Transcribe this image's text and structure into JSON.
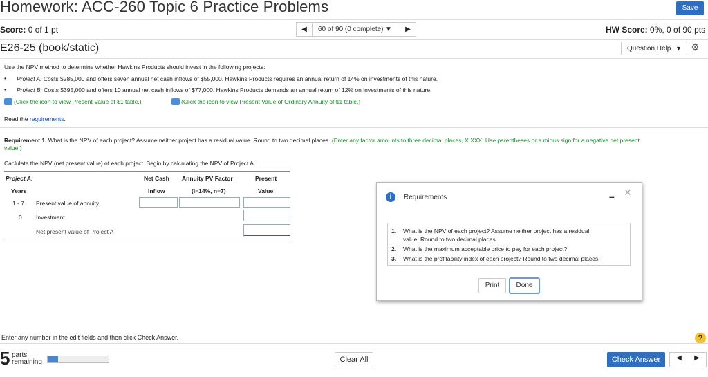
{
  "header": {
    "title": "Homework: ACC-260 Topic 6 Practice Problems",
    "save_label": "Save"
  },
  "score_bar": {
    "score_label": "Score:",
    "score_value": " 0 of 1 pt",
    "nav_label": "60 of 90 (0 complete)",
    "hw_score_label": "HW Score:",
    "hw_score_value": " 0%, 0 of 90 pts"
  },
  "problem": {
    "id": "E26-25 (book/static)",
    "question_help_label": "Question Help"
  },
  "question": {
    "intro": "Use the NPV method to determine whether Hawkins Products should invest in the following projects:",
    "bullets": [
      {
        "label": "Project A:",
        "text": " Costs $285,000 and offers seven annual net cash inflows of $55,000. Hawkins Products requires an annual return of 14% on investments of this nature."
      },
      {
        "label": "Project B:",
        "text": " Costs $395,000 and offers 10 annual net cash inflows of $77,000. Hawkins Products demands an annual return of 12% on investments of this nature."
      }
    ],
    "link_pv": "(Click the icon to view Present Value of $1 table.)",
    "link_pva": "(Click the icon to view Present Value of Ordinary Annuity of $1 table.)",
    "read_prefix": "Read the ",
    "read_link": "requirements",
    "read_suffix": "."
  },
  "requirement": {
    "label": "Requirement 1.",
    "text": " What is the NPV of each project? Assume neither project has a residual value. Round to two decimal places. ",
    "hint_line1": "(Enter any factor amounts to three decimal places, X.XXX. Use parentheses or a minus sign for a negative net present",
    "hint_line2": "value.)",
    "instruction": "Caclulate the NPV (net present value) of each project. Begin by calculating the NPV of Project A."
  },
  "table": {
    "project_label": "Project A:",
    "col_years": "Years",
    "col_cash_1": "Net Cash",
    "col_cash_2": "Inflow",
    "col_factor_1": "Annuity PV Factor",
    "col_factor_2": "(i=14%, n=7)",
    "col_value_1": "Present",
    "col_value_2": "Value",
    "rows": [
      {
        "years": "1 - 7",
        "label": "Present value of annuity"
      },
      {
        "years": "0",
        "label": "Investment"
      },
      {
        "years": "",
        "label": "Net present value of Project A"
      }
    ]
  },
  "footer": {
    "instruction": "Enter any number in the edit fields and then click Check Answer.",
    "parts_num": "5",
    "parts_line1": "parts",
    "parts_line2": "remaining",
    "progress_fraction": 0.17,
    "clear_label": "Clear All",
    "check_label": "Check Answer",
    "help_symbol": "?"
  },
  "modal": {
    "title": "Requirements",
    "items": [
      {
        "num": "1.",
        "line1": "What is the NPV of each project? Assume neither project has a residual",
        "line2": "value. Round to two decimal places."
      },
      {
        "num": "2.",
        "line1": "What is the maximum acceptable price to pay for each project?",
        "line2": ""
      },
      {
        "num": "3.",
        "line1": "What is the profitability index of each project? Round to two decimal places.",
        "line2": ""
      }
    ],
    "print_label": "Print",
    "done_label": "Done"
  },
  "colors": {
    "accent": "#2e6fc1",
    "hint_green": "#1a8a2a",
    "link_blue": "#1a4fbf"
  }
}
